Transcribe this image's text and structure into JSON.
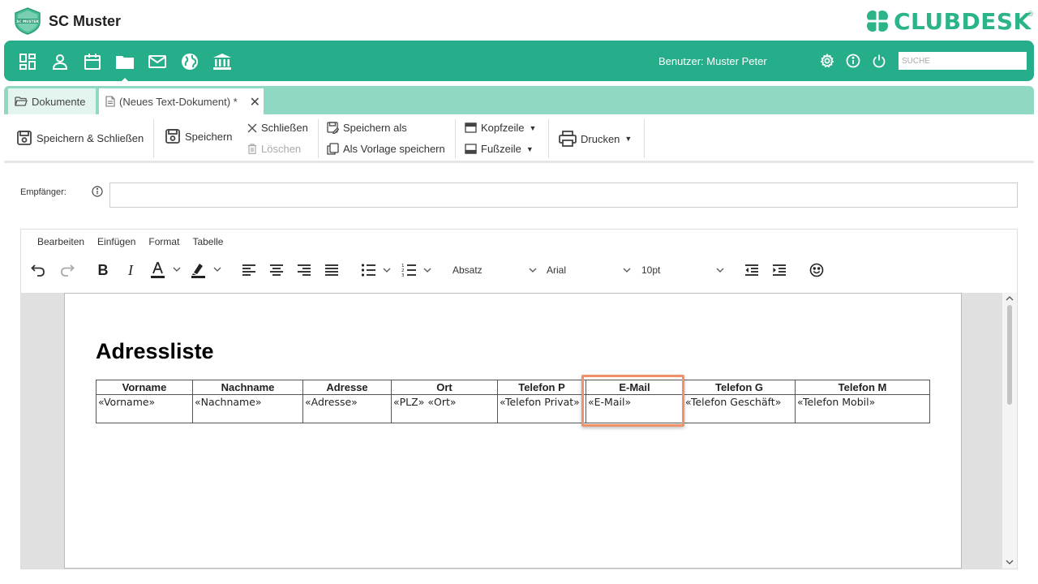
{
  "brand": {
    "club_name": "SC Muster",
    "club_logo_text": "SC MUSTER",
    "product_name": "CLUBDESK",
    "registered_mark": "®"
  },
  "nav": {
    "icons": [
      "dashboard-icon",
      "person-icon",
      "calendar-icon",
      "folder-icon",
      "mail-icon",
      "globe-icon",
      "bank-icon"
    ],
    "active": "folder-icon",
    "user_label": "Benutzer: Muster Peter",
    "search_placeholder": "SUCHE"
  },
  "tabs": [
    {
      "label": "Dokumente"
    },
    {
      "label": "(Neues Text-Dokument) *"
    }
  ],
  "tab_close_glyph": "✕",
  "toolbar": {
    "save_close": "Speichern & Schließen",
    "save": "Speichern",
    "close": "Schließen",
    "delete": "Löschen",
    "save_as": "Speichern als",
    "save_template": "Als Vorlage speichern",
    "header": "Kopfzeile",
    "footer": "Fußzeile",
    "print": "Drucken",
    "caret": "▼"
  },
  "recipient": {
    "label": "Empfänger:",
    "value": ""
  },
  "editor": {
    "menu": [
      "Bearbeiten",
      "Einfügen",
      "Format",
      "Tabelle"
    ],
    "block_format": "Absatz",
    "font_family": "Arial",
    "font_size": "10pt"
  },
  "document": {
    "title": "Adressliste",
    "columns": [
      "Vorname",
      "Nachname",
      "Adresse",
      "Ort",
      "Telefon P",
      "E-Mail",
      "Telefon G",
      "Telefon M"
    ],
    "row": [
      "«Vorname»",
      "«Nachname»",
      "«Adresse»",
      "«PLZ» «Ort»",
      "«Telefon Privat»",
      "«E-Mail»",
      "«Telefon Geschäft»",
      "«Telefon Mobil»"
    ],
    "highlighted_column": "E-Mail"
  },
  "colors": {
    "brand_green": "#26ad8a",
    "tab_bar": "#8ed8c4",
    "highlight": "#f0916a"
  }
}
